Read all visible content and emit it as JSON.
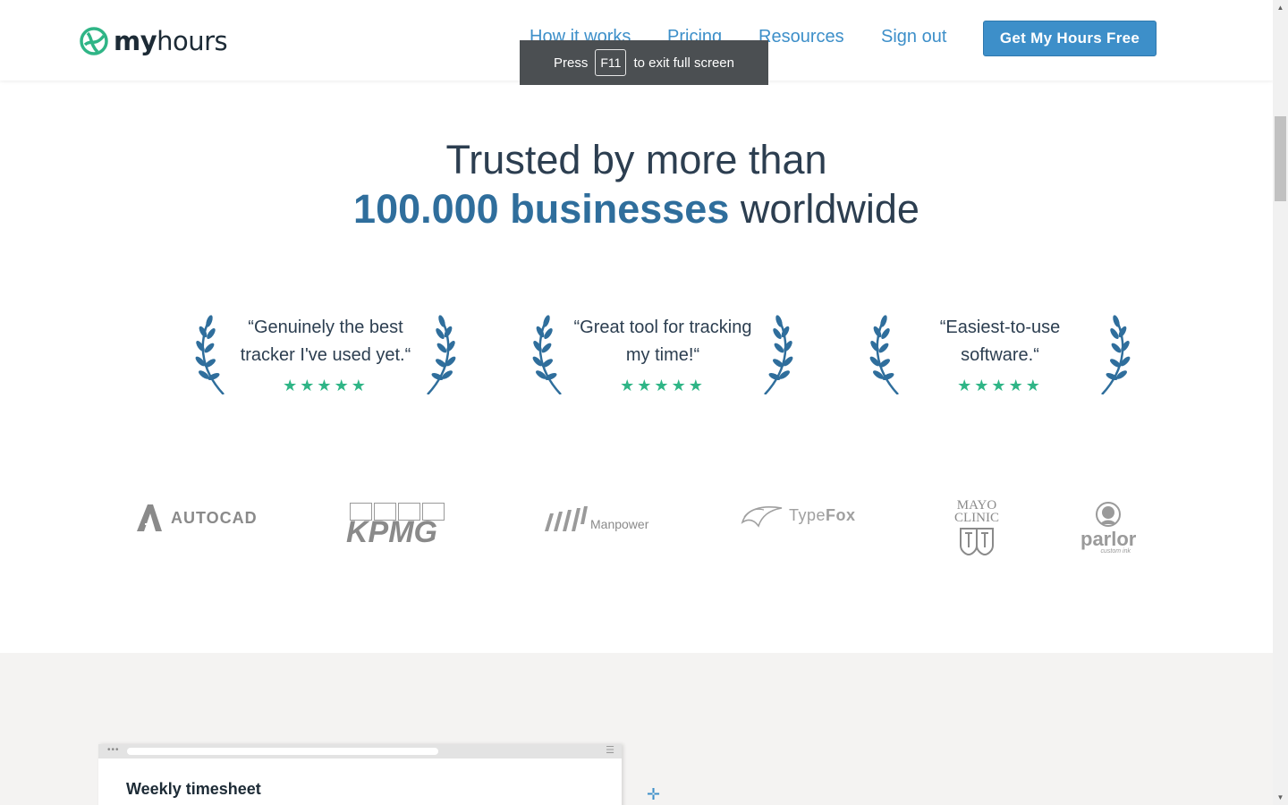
{
  "brand": {
    "name_bold": "my",
    "name_light": "hours",
    "accent": "#3d8fc9",
    "logo_green": "#2fb586"
  },
  "nav": {
    "items": [
      {
        "label": "How it works"
      },
      {
        "label": "Pricing"
      },
      {
        "label": "Resources"
      },
      {
        "label": "Sign out"
      }
    ],
    "cta_label": "Get My Hours Free"
  },
  "toast": {
    "press": "Press",
    "key": "F11",
    "suffix": "to exit full screen"
  },
  "headline": {
    "line1": "Trusted by more than",
    "accent": "100.000 businesses",
    "rest": "worldwide"
  },
  "testimonials": [
    {
      "quote": "“Genuinely the best tracker I've used yet.“",
      "stars": 5
    },
    {
      "quote": "“Great tool for tracking my time!“",
      "stars": 5
    },
    {
      "quote": "“Easiest-to-use software.“",
      "stars": 5
    }
  ],
  "clients": [
    {
      "name": "AUTOCAD"
    },
    {
      "name": "KPMG"
    },
    {
      "name": "Manpower"
    },
    {
      "name_light": "Type",
      "name_bold": "Fox"
    },
    {
      "line1": "MAYO",
      "line2": "CLINIC"
    },
    {
      "name": "parlor",
      "tagline": "custom ink"
    }
  ],
  "preview": {
    "title": "Weekly timesheet"
  }
}
